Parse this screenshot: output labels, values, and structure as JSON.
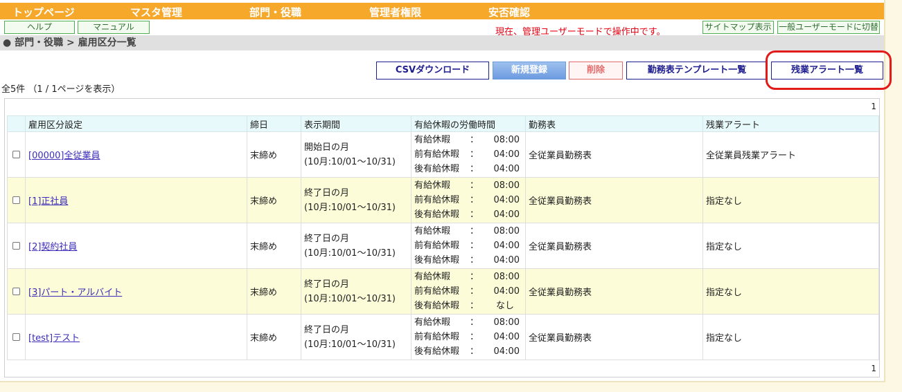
{
  "nav": {
    "items": [
      "トップページ",
      "マスタ管理",
      "部門・役職",
      "管理者権限",
      "安否確認"
    ]
  },
  "sub": {
    "help": "ヘルプ",
    "manual": "マニュアル",
    "mode_status": "現在、管理ユーザーモードで操作中です。",
    "sitemap": "サイトマップ表示",
    "switch_mode": "一般ユーザーモードに切替"
  },
  "breadcrumb": "● 部門・役職 > 雇用区分一覧",
  "actions": {
    "csv": "CSVダウンロード",
    "new": "新規登録",
    "delete": "削除",
    "template_list": "勤務表テンプレート一覧",
    "overtime_list": "残業アラート一覧"
  },
  "count_text": "全5件 （1 / 1ページを表示）",
  "pager": {
    "top": "1",
    "bottom": "1"
  },
  "table": {
    "headers": [
      "雇用区分設定",
      "締日",
      "表示期間",
      "有給休暇の労働時間",
      "勤務表",
      "残業アラート"
    ],
    "rows": [
      {
        "name": "[00000]全従業員",
        "closing": "末締め",
        "period_line1": "開始日の月",
        "period_line2": "(10月:10/01～10/31)",
        "leave": [
          {
            "label": "有給休暇",
            "colon": "：",
            "value": "08:00"
          },
          {
            "label": "前有給休暇",
            "colon": "：",
            "value": "04:00"
          },
          {
            "label": "後有給休暇",
            "colon": "：",
            "value": "04:00"
          }
        ],
        "worksheet": "全従業員勤務表",
        "overtime": "全従業員残業アラート"
      },
      {
        "name": "[1]正社員",
        "closing": "末締め",
        "period_line1": "終了日の月",
        "period_line2": "(10月:10/01～10/31)",
        "leave": [
          {
            "label": "有給休暇",
            "colon": "：",
            "value": "08:00"
          },
          {
            "label": "前有給休暇",
            "colon": "：",
            "value": "04:00"
          },
          {
            "label": "後有給休暇",
            "colon": "：",
            "value": "04:00"
          }
        ],
        "worksheet": "全従業員勤務表",
        "overtime": "指定なし"
      },
      {
        "name": "[2]契約社員",
        "closing": "末締め",
        "period_line1": "終了日の月",
        "period_line2": "(10月:10/01～10/31)",
        "leave": [
          {
            "label": "有給休暇",
            "colon": "：",
            "value": "08:00"
          },
          {
            "label": "前有給休暇",
            "colon": "：",
            "value": "04:00"
          },
          {
            "label": "後有給休暇",
            "colon": "：",
            "value": "04:00"
          }
        ],
        "worksheet": "全従業員勤務表",
        "overtime": "指定なし"
      },
      {
        "name": "[3]パート・アルバイト",
        "closing": "末締め",
        "period_line1": "終了日の月",
        "period_line2": "(10月:10/01～10/31)",
        "leave": [
          {
            "label": "有給休暇",
            "colon": "：",
            "value": "08:00"
          },
          {
            "label": "前有給休暇",
            "colon": "：",
            "value": "04:00"
          },
          {
            "label": "後有給休暇",
            "colon": "：",
            "value": "なし"
          }
        ],
        "worksheet": "全従業員勤務表",
        "overtime": "指定なし"
      },
      {
        "name": "[test]テスト",
        "closing": "末締め",
        "period_line1": "終了日の月",
        "period_line2": "(10月:10/01～10/31)",
        "leave": [
          {
            "label": "有給休暇",
            "colon": "：",
            "value": "08:00"
          },
          {
            "label": "前有給休暇",
            "colon": "：",
            "value": "04:00"
          },
          {
            "label": "後有給休暇",
            "colon": "：",
            "value": "04:00"
          }
        ],
        "worksheet": "全従業員勤務表",
        "overtime": "指定なし"
      }
    ]
  }
}
